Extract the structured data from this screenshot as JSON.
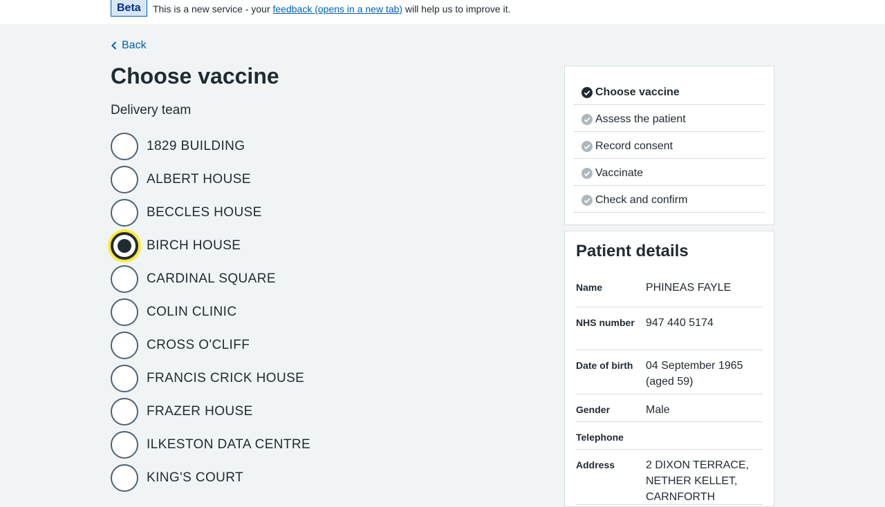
{
  "banner": {
    "tag": "Beta",
    "text_before": "This is a new service - your ",
    "link_text": "feedback (opens in a new tab)",
    "text_after": " will help us to improve it."
  },
  "back_label": "Back",
  "page_title": "Choose vaccine",
  "delivery_team": {
    "legend": "Delivery team",
    "options": [
      {
        "label": "1829 BUILDING",
        "selected": false
      },
      {
        "label": "ALBERT HOUSE",
        "selected": false
      },
      {
        "label": "BECCLES HOUSE",
        "selected": false
      },
      {
        "label": "BIRCH HOUSE",
        "selected": true
      },
      {
        "label": "CARDINAL SQUARE",
        "selected": false
      },
      {
        "label": "COLIN CLINIC",
        "selected": false
      },
      {
        "label": "CROSS O'CLIFF",
        "selected": false
      },
      {
        "label": "FRANCIS CRICK HOUSE",
        "selected": false
      },
      {
        "label": "FRAZER HOUSE",
        "selected": false
      },
      {
        "label": "ILKESTON DATA CENTRE",
        "selected": false
      },
      {
        "label": "KING'S COURT",
        "selected": false
      }
    ]
  },
  "task_list": {
    "items": [
      {
        "label": "Choose vaccine",
        "state": "current"
      },
      {
        "label": "Assess the patient",
        "state": "pending"
      },
      {
        "label": "Record consent",
        "state": "pending"
      },
      {
        "label": "Vaccinate",
        "state": "pending"
      },
      {
        "label": "Check and confirm",
        "state": "pending"
      }
    ]
  },
  "patient": {
    "title": "Patient details",
    "rows": [
      {
        "key": "Name",
        "value": "PHINEAS FAYLE"
      },
      {
        "key": "NHS number",
        "value": "947 440 5174"
      },
      {
        "key": "Date of birth",
        "value": "04 September 1965 (aged 59)"
      },
      {
        "key": "Gender",
        "value": "Male"
      },
      {
        "key": "Telephone",
        "value": ""
      },
      {
        "key": "Address",
        "value": "2 DIXON TERRACE, NETHER KELLET, CARNFORTH"
      }
    ]
  },
  "colors": {
    "link": "#005eb8",
    "text": "#212b32",
    "focus": "#ffeb3b",
    "background": "#f0f4f5",
    "tick_current": "#212b32",
    "tick_pending": "#aeb7bd"
  }
}
